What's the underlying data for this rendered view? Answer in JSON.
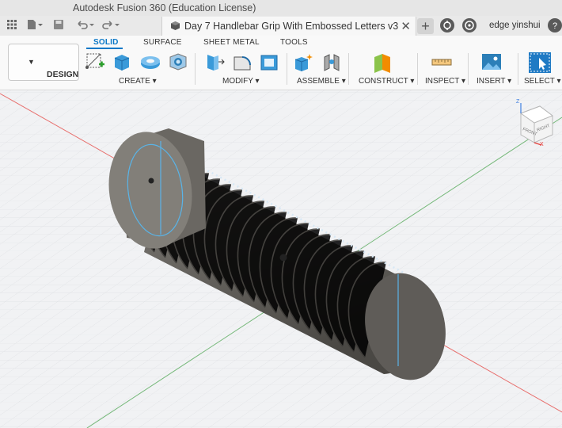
{
  "app": {
    "title": "Autodesk Fusion 360 (Education License)"
  },
  "document": {
    "tab_title": "Day 7 Handlebar Grip With Embossed Letters v3"
  },
  "user": {
    "name": "edge yinshui"
  },
  "workspace": {
    "label": "DESIGN"
  },
  "tabs": [
    {
      "label": "SOLID",
      "active": true
    },
    {
      "label": "SURFACE",
      "active": false
    },
    {
      "label": "SHEET METAL",
      "active": false
    },
    {
      "label": "TOOLS",
      "active": false
    }
  ],
  "groups": [
    {
      "label": "CREATE",
      "icons": [
        "create-sketch-icon",
        "extrude-icon",
        "revolve-icon",
        "hole-icon"
      ]
    },
    {
      "label": "MODIFY",
      "icons": [
        "press-pull-icon",
        "fillet-icon",
        "shell-icon"
      ]
    },
    {
      "label": "ASSEMBLE",
      "icons": [
        "new-component-icon",
        "joint-icon"
      ]
    },
    {
      "label": "CONSTRUCT",
      "icons": [
        "offset-plane-icon"
      ]
    },
    {
      "label": "INSPECT",
      "icons": [
        "measure-icon"
      ]
    },
    {
      "label": "INSERT",
      "icons": [
        "insert-image-icon"
      ]
    },
    {
      "label": "SELECT",
      "icons": [
        "select-icon"
      ]
    }
  ],
  "viewcube": {
    "faces": [
      "FRONT",
      "RIGHT"
    ],
    "axes": [
      "Z",
      "X"
    ]
  },
  "colors": {
    "accent": "#0b78c7",
    "axis_x": "#e53935",
    "axis_y": "#43a047",
    "model": "#6f6c67"
  }
}
